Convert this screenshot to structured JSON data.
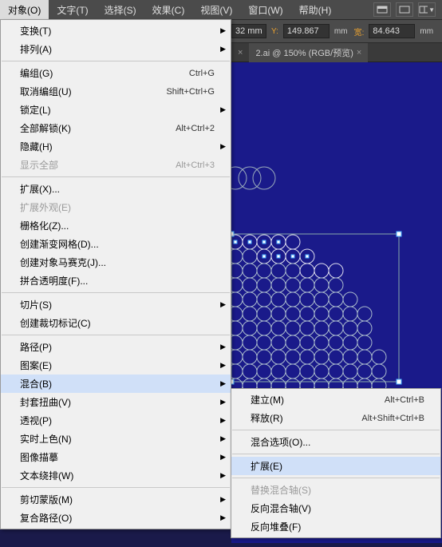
{
  "menubar": {
    "items": [
      "对象(O)",
      "文字(T)",
      "选择(S)",
      "效果(C)",
      "视图(V)",
      "窗口(W)",
      "帮助(H)"
    ]
  },
  "toolbar": {
    "x_unit": "32 mm",
    "y_label": "Y:",
    "y_value": "149.867",
    "w_label": "宽:",
    "w_value": "84.643",
    "mm": "mm"
  },
  "tabs": {
    "close1": "×",
    "tab2_label": "2.ai @ 150% (RGB/预览)",
    "close2": "×"
  },
  "menu": {
    "transform": "变换(T)",
    "arrange": "排列(A)",
    "group": "编组(G)",
    "group_sc": "Ctrl+G",
    "ungroup": "取消编组(U)",
    "ungroup_sc": "Shift+Ctrl+G",
    "lock": "锁定(L)",
    "unlockAll": "全部解锁(K)",
    "unlockAll_sc": "Alt+Ctrl+2",
    "hide": "隐藏(H)",
    "showAll": "显示全部",
    "showAll_sc": "Alt+Ctrl+3",
    "expand": "扩展(X)...",
    "expandAppearance": "扩展外观(E)",
    "rasterize": "栅格化(Z)...",
    "gradientMesh": "创建渐变网格(D)...",
    "objectMosaic": "创建对象马赛克(J)...",
    "flatten": "拼合透明度(F)...",
    "slice": "切片(S)",
    "cropMarks": "创建裁切标记(C)",
    "path": "路径(P)",
    "pattern": "图案(E)",
    "blend": "混合(B)",
    "envelope": "封套扭曲(V)",
    "perspective": "透视(P)",
    "livePaint": "实时上色(N)",
    "imageTrace": "图像描摹",
    "textWrap": "文本绕排(W)",
    "clipMask": "剪切蒙版(M)",
    "compoundPath": "复合路径(O)"
  },
  "submenu": {
    "make": "建立(M)",
    "make_sc": "Alt+Ctrl+B",
    "release": "释放(R)",
    "release_sc": "Alt+Shift+Ctrl+B",
    "options": "混合选项(O)...",
    "expand": "扩展(E)",
    "replaceSpine": "替换混合轴(S)",
    "reverseSpine": "反向混合轴(V)",
    "reverseFront": "反向堆叠(F)"
  }
}
